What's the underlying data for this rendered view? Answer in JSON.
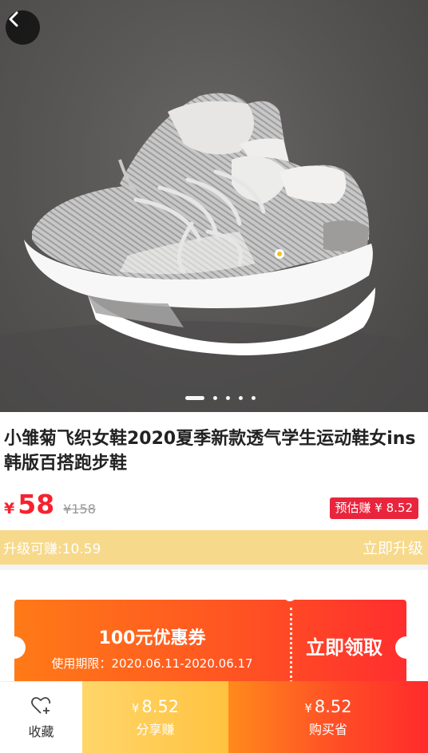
{
  "product": {
    "title": "小雏菊飞织女鞋2020夏季新款透气学生运动鞋女ins韩版百搭跑步鞋",
    "price_symbol": "¥",
    "price": "58",
    "original_price": "¥158",
    "estimated_earn": "预估赚 ¥ 8.52"
  },
  "gallery": {
    "slide_count": 5,
    "active_slide": 1
  },
  "upgrade": {
    "text": "升级可赚:10.59",
    "link": "立即升级"
  },
  "coupon": {
    "title": "100元优惠券",
    "validity": "使用期限：2020.06.11-2020.06.17",
    "action": "立即领取"
  },
  "bottom_bar": {
    "favorite_label": "收藏",
    "share_amount_symbol": "¥",
    "share_amount": "8.52",
    "share_label": "分享赚",
    "buy_amount_symbol": "¥",
    "buy_amount": "8.52",
    "buy_label": "购买省"
  },
  "icons": {
    "back": "chevron-left-icon",
    "favorite": "heart-plus-icon"
  },
  "colors": {
    "accent_red": "#f5222d",
    "badge_red": "#e8253d",
    "upgrade_bar": "#f7d98b",
    "coupon_orange": "#ff6a1a"
  }
}
